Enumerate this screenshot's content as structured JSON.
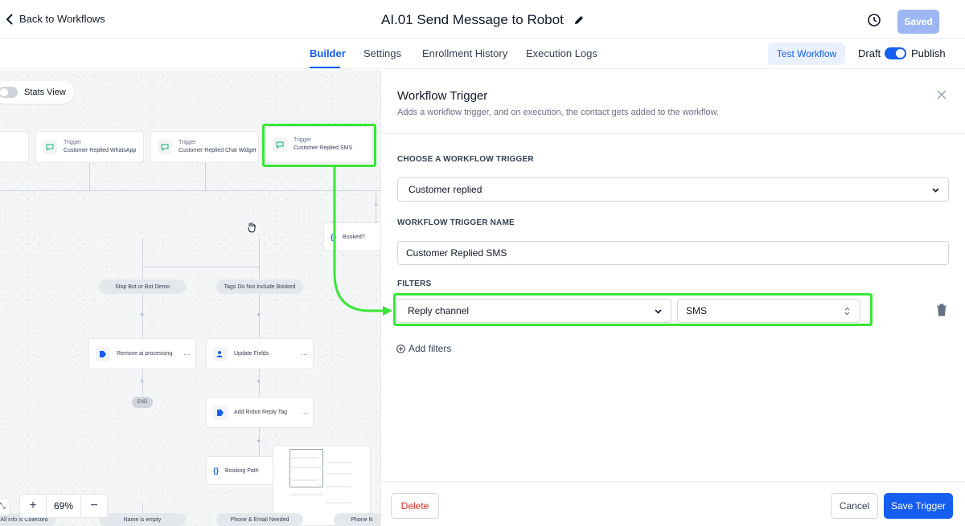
{
  "header": {
    "back_label": "Back to Workflows",
    "title": "AI.01 Send Message to Robot",
    "saved_label": "Saved"
  },
  "tabs": {
    "items": [
      {
        "label": "Builder",
        "active": true
      },
      {
        "label": "Settings",
        "active": false
      },
      {
        "label": "Enrollment History",
        "active": false
      },
      {
        "label": "Execution Logs",
        "active": false
      }
    ],
    "test_label": "Test Workflow",
    "draft_label": "Draft",
    "publish_label": "Publish",
    "publish_on": true
  },
  "canvas": {
    "stats_view_label": "Stats View",
    "triggers": [
      {
        "kind": "Trigger",
        "name": "Customer Replied WhatsApp"
      },
      {
        "kind": "Trigger",
        "name": "Customer Replied Chat Widget"
      },
      {
        "kind": "Trigger",
        "name": "Customer Replied SMS"
      }
    ],
    "condition_node": "Booked?",
    "branches": [
      "Stop Bot or Bot Demo",
      "Tags Do Not Include Booked"
    ],
    "actions": {
      "remove_ai": "Remove ai processing",
      "update_fields": "Update Fields",
      "add_tag": "Add Robot Reply Tag",
      "booking_path": "Booking Path"
    },
    "end_label": "END",
    "bottom_branches": [
      "All info is Collected",
      "Name is empty",
      "Phone & Email Needed",
      "Phone N"
    ],
    "zoom": "69%",
    "zoom_in": "+",
    "zoom_out": "−"
  },
  "panel": {
    "title": "Workflow Trigger",
    "subtitle": "Adds a workflow trigger, and on execution, the contact gets added to the workflow.",
    "choose_label": "CHOOSE A WORKFLOW TRIGGER",
    "trigger_value": "Customer replied",
    "name_label": "WORKFLOW TRIGGER NAME",
    "name_value": "Customer Replied SMS",
    "filters_label": "FILTERS",
    "filter_field": "Reply channel",
    "filter_value": "SMS",
    "add_filters": "Add filters",
    "delete_label": "Delete",
    "cancel_label": "Cancel",
    "save_label": "Save Trigger"
  },
  "colors": {
    "accent": "#155eef",
    "highlight": "#39e635",
    "danger": "#d92d20"
  }
}
